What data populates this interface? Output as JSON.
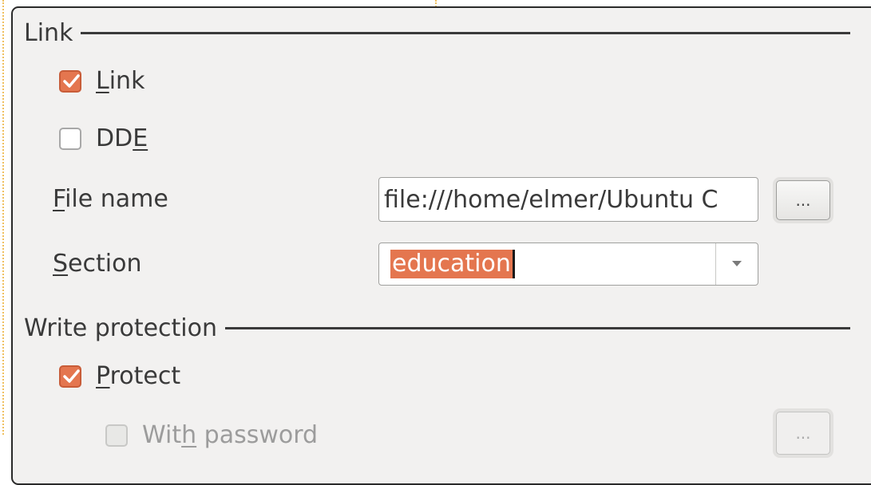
{
  "link_section": {
    "header": "Link",
    "link_checkbox": {
      "label_pre": "",
      "label_mn": "L",
      "label_post": "ink",
      "checked": true
    },
    "dde_checkbox": {
      "label_pre": "DD",
      "label_mn": "E",
      "label_post": "",
      "checked": false
    },
    "file_name": {
      "label_mn": "F",
      "label_post": "ile name",
      "value": "file:///home/elmer/Ubuntu C",
      "button_label": "..."
    },
    "section": {
      "label_mn": "S",
      "label_post": "ection",
      "value": "education"
    }
  },
  "write_protection": {
    "header": "Write protection",
    "protect_checkbox": {
      "label_pre": "",
      "label_mn": "P",
      "label_post": "rotect",
      "checked": true
    },
    "password_checkbox": {
      "label_pre": "Wit",
      "label_mn": "h",
      "label_post": " password",
      "checked": false,
      "enabled": false
    },
    "password_button_label": "..."
  },
  "colors": {
    "accent": "#e4764f",
    "panel": "#f2f1f0"
  },
  "icons": {
    "check": "check-icon",
    "dropdown": "chevron-down-icon"
  }
}
